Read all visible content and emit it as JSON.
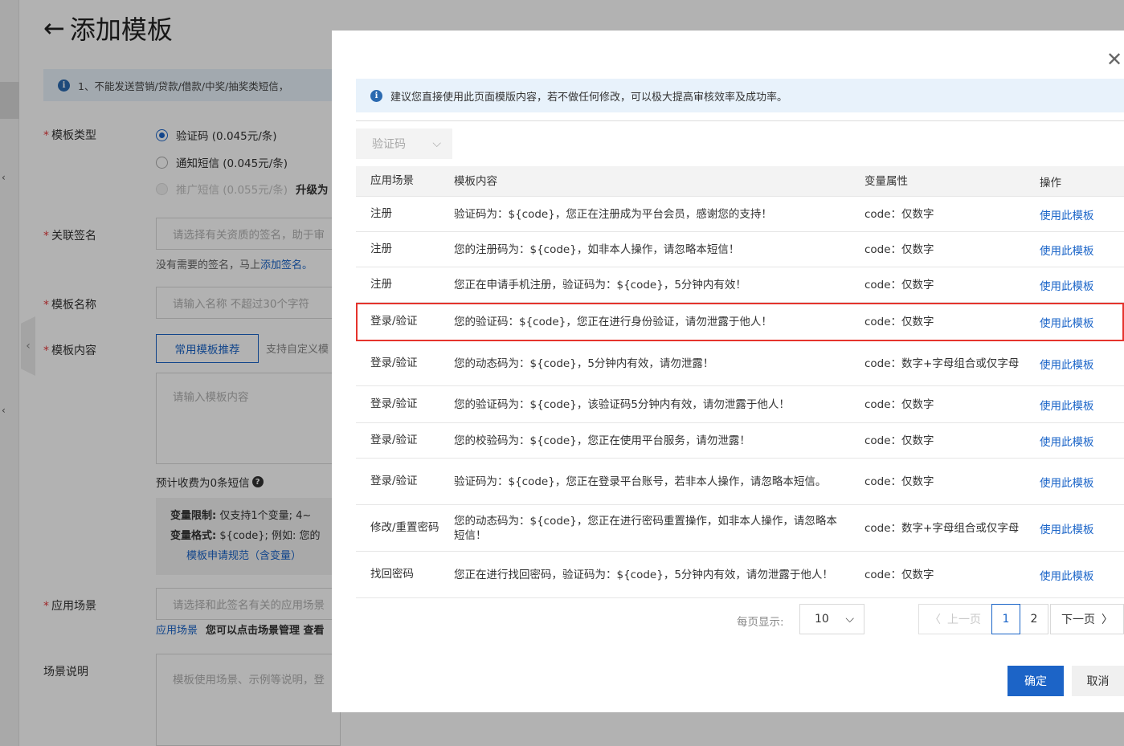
{
  "page": {
    "title": "添加模板",
    "notice": "1、不能发送营销/贷款/借款/中奖/抽奖类短信，",
    "fields": {
      "template_type": "模板类型",
      "signature": "关联签名",
      "template_name": "模板名称",
      "template_content": "模板内容",
      "scenario": "应用场景",
      "scenario_desc": "场景说明"
    },
    "type_options": [
      {
        "label": "验证码 (0.045元/条)",
        "selected": true
      },
      {
        "label": "通知短信 (0.045元/条)",
        "selected": false
      },
      {
        "label": "推广短信 (0.055元/条)",
        "disabled": true
      }
    ],
    "upgrade_label": "升级为",
    "signature_placeholder": "请选择有关资质的签名，助于审",
    "signature_hint_text": "没有需要的签名，马上",
    "signature_hint_link": "添加签名。",
    "name_placeholder": "请输入名称 不超过30个字符",
    "recommend_button": "常用模板推荐",
    "support_text": "支持自定义模",
    "content_placeholder": "请输入模板内容",
    "estimate": "预计收费为0条短信",
    "var_limit_label": "变量限制:",
    "var_limit_text": "仅支持1个变量; 4~",
    "var_format_label": "变量格式:",
    "var_format_text": "${code}; 例如: 您的",
    "spec_link": "模板申请规范（含变量）",
    "scenario_placeholder": "请选择和此签名有关的应用场景",
    "scenario_link": "应用场景",
    "scenario_hint": "您可以点击场景管理 查看",
    "desc_placeholder": "模板使用场景、示例等说明，登"
  },
  "modal": {
    "tip": "建议您直接使用此页面模版内容，若不做任何修改，可以极大提高审核效率及成功率。",
    "filter": "验证码",
    "columns": [
      "应用场景",
      "模板内容",
      "变量属性",
      "操作"
    ],
    "rows": [
      {
        "scene": "注册",
        "content": "验证码为：${code}，您正在注册成为平台会员，感谢您的支持！",
        "attr": "code：仅数字",
        "action": "使用此模板"
      },
      {
        "scene": "注册",
        "content": "您的注册码为：${code}，如非本人操作，请忽略本短信！",
        "attr": "code：仅数字",
        "action": "使用此模板"
      },
      {
        "scene": "注册",
        "content": "您正在申请手机注册，验证码为：${code}，5分钟内有效！",
        "attr": "code：仅数字",
        "action": "使用此模板"
      },
      {
        "scene": "登录/验证",
        "content": "您的验证码：${code}，您正在进行身份验证，请勿泄露于他人！",
        "attr": "code：仅数字",
        "action": "使用此模板",
        "highlight": true
      },
      {
        "scene": "登录/验证",
        "content": "您的动态码为：${code}，5分钟内有效，请勿泄露！",
        "attr": "code：数字+字母组合或仅字母",
        "action": "使用此模板"
      },
      {
        "scene": "登录/验证",
        "content": "您的验证码为：${code}，该验证码5分钟内有效，请勿泄露于他人！",
        "attr": "code：仅数字",
        "action": "使用此模板"
      },
      {
        "scene": "登录/验证",
        "content": "您的校验码为：${code}，您正在使用平台服务，请勿泄露！",
        "attr": "code：仅数字",
        "action": "使用此模板"
      },
      {
        "scene": "登录/验证",
        "content": "验证码为：${code}，您正在登录平台账号，若非本人操作，请忽略本短信。",
        "attr": "code：仅数字",
        "action": "使用此模板"
      },
      {
        "scene": "修改/重置密码",
        "content": "您的动态码为：${code}，您正在进行密码重置操作，如非本人操作，请忽略本短信！",
        "attr": "code：数字+字母组合或仅字母",
        "action": "使用此模板"
      },
      {
        "scene": "找回密码",
        "content": "您正在进行找回密码，验证码为：${code}，5分钟内有效，请勿泄露于他人！",
        "attr": "code：仅数字",
        "action": "使用此模板"
      }
    ],
    "pagination": {
      "page_size_label": "每页显示:",
      "page_size": "10",
      "prev": "上一页",
      "pages": [
        "1",
        "2"
      ],
      "current": "1",
      "next": "下一页"
    },
    "confirm": "确定",
    "cancel": "取消"
  }
}
